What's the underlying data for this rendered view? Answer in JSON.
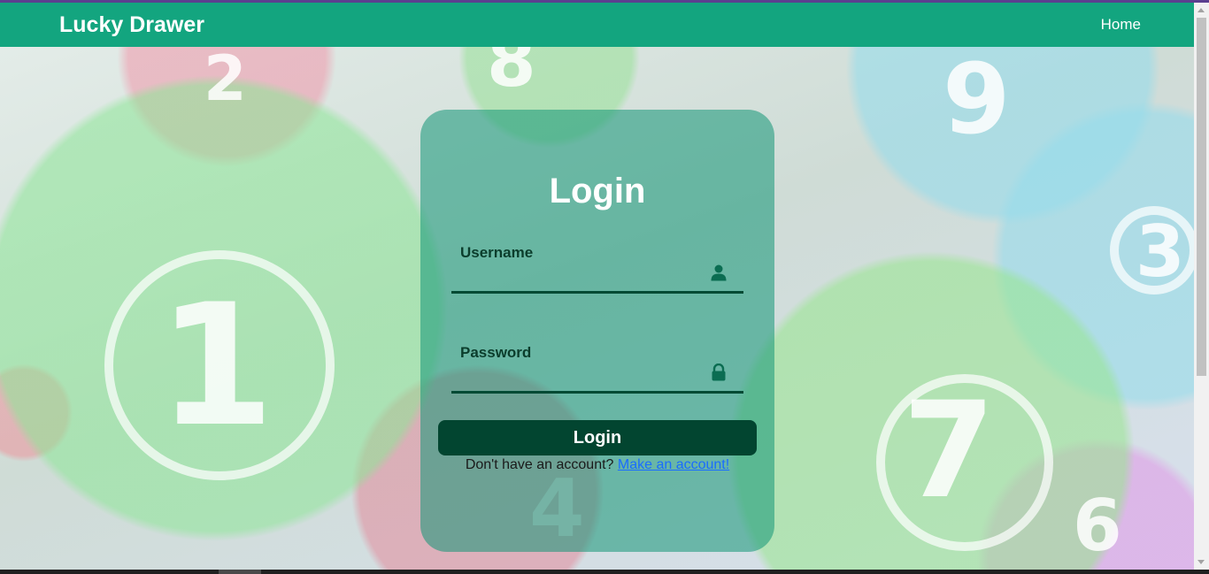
{
  "navbar": {
    "brand": "Lucky Drawer",
    "home_link": "Home"
  },
  "background": {
    "ball_numbers": [
      "1",
      "2",
      "3",
      "4",
      "6",
      "7",
      "8",
      "9"
    ]
  },
  "login": {
    "title": "Login",
    "username_label": "Username",
    "username_value": "",
    "password_label": "Password",
    "password_value": "",
    "button_label": "Login",
    "signup_prompt": "Don't have an account?",
    "signup_link": "Make an account!"
  },
  "icons": {
    "username": "user-icon",
    "password": "lock-icon"
  },
  "colors": {
    "navbar": "#13a57f",
    "button": "#024530",
    "field_underline": "#024a34",
    "link": "#1a6cff"
  }
}
